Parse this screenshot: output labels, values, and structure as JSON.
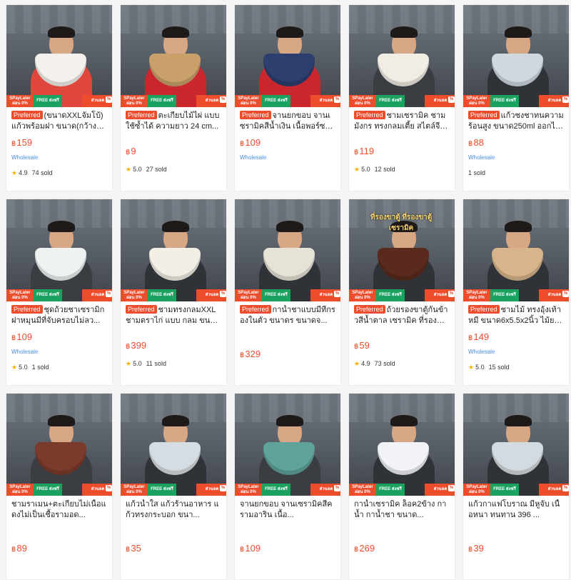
{
  "colors": {
    "accent": "#ee4d2d",
    "wholesale": "#4a90e2",
    "star": "#f5b301",
    "ship": "#1aa260"
  },
  "currency": "฿",
  "badges": {
    "paylater": "SPayLater ผ่อน 0%",
    "shipping": "FREE ส่งฟรี",
    "discount": "ส่วนลด"
  },
  "products": [
    {
      "tag": "Preferred",
      "title": "(ขนาดXXLจัมโบ้)แก้วพร้อมฝา ขนาด(กว้าง4.5สูง...",
      "price": "159",
      "wholesale": "Wholesale",
      "rating": "4.9",
      "sold": "74 sold",
      "shirt": "#e0463b",
      "product": "#f4f1ec",
      "overlay": ""
    },
    {
      "tag": "Preferred",
      "title": "ตะเกียบไม้ไผ่ แบบใช้ซ้ำได้ ความยาว 24 cm...",
      "price": "9",
      "wholesale": "",
      "rating": "5.0",
      "sold": "27 sold",
      "shirt": "#c9272d",
      "product": "#c9a06a",
      "overlay": ""
    },
    {
      "tag": "Preferred",
      "title": "จานยกขอบ จานเซรามิคสีน้ำเงิน เนื้อพอร์ซเล...",
      "price": "109",
      "wholesale": "Wholesale",
      "rating": "",
      "sold": "",
      "shirt": "#c9272d",
      "product": "#2c3f6e",
      "overlay": ""
    },
    {
      "tag": "Preferred",
      "title": "ชามเซรามิค ชามมังกร ทรงกลมเตี้ย สไตล์จีน ลา...",
      "price": "119",
      "wholesale": "",
      "rating": "5.0",
      "sold": "12 sold",
      "shirt": "#3a3d42",
      "product": "#f2ede4",
      "overlay": ""
    },
    {
      "tag": "Preferred",
      "title": "แก้วชงชาทนความร้อนสูง ขนาด250ml ออกไป...",
      "price": "88",
      "wholesale": "Wholesale",
      "rating": "",
      "sold": "1 sold",
      "shirt": "#2f3338",
      "product": "#cfd8de",
      "overlay": ""
    },
    {
      "tag": "Preferred",
      "title": "ชุดถ้วยชาเซรามิกฝาหมุนมีที่จับครอบไม่ลว...",
      "price": "109",
      "wholesale": "Wholesale",
      "rating": "5.0",
      "sold": "1 sold",
      "shirt": "#3a3d42",
      "product": "#eef2f0",
      "overlay": ""
    },
    {
      "tag": "Preferred",
      "title": "ชามทรงกลมXXL ชามตราไก่ แบบ กลม ขนาด...",
      "price": "399",
      "wholesale": "",
      "rating": "5.0",
      "sold": "11 sold",
      "shirt": "#2f3338",
      "product": "#f3efe6",
      "overlay": ""
    },
    {
      "tag": "Preferred",
      "title": "กาน้ำชาแบบมีที่กรองในตัว ขนาดร ขนาดจ...",
      "price": "329",
      "wholesale": "",
      "rating": "",
      "sold": "",
      "shirt": "#2f3338",
      "product": "#e7e2d6",
      "overlay": ""
    },
    {
      "tag": "Preferred",
      "title": "ถ้วยรองขาตู้กันข้าวสีน้ำตาล เซรามิค ที่รองขาตู้...",
      "price": "59",
      "wholesale": "",
      "rating": "4.9",
      "sold": "73 sold",
      "shirt": "#2f3338",
      "product": "#5a2a1c",
      "overlay": "ที่รองขาตู้ ที่รองขาตู้ เซรามิค"
    },
    {
      "tag": "Preferred",
      "title": "ชามไม้ ทรงอุ้งเท้าหมี ขนาด6x5.5x2นิ้ว ไม้ยาง...",
      "price": "149",
      "wholesale": "Wholesale",
      "rating": "5.0",
      "sold": "15 sold",
      "shirt": "#2f3338",
      "product": "#d8b48a",
      "overlay": ""
    },
    {
      "tag": "",
      "title": "ชามราเมน+ตะเกียบไม่เนื้อแดงไม่เป็นเชื้อรามอด...",
      "price": "89",
      "wholesale": "",
      "rating": "",
      "sold": "",
      "shirt": "#3a3d42",
      "product": "#7b3b2c",
      "overlay": ""
    },
    {
      "tag": "",
      "title": "แก้วน้ำใส แก้วร้านอาหาร แก้วทรงกระบอก ขนา...",
      "price": "35",
      "wholesale": "",
      "rating": "",
      "sold": "",
      "shirt": "#2f3338",
      "product": "#d6dde2",
      "overlay": ""
    },
    {
      "tag": "",
      "title": "จานยกขอบ จานเซรามิคสีครามอาริน เนื้อ...",
      "price": "109",
      "wholesale": "",
      "rating": "",
      "sold": "",
      "shirt": "#3a3d42",
      "product": "#5fa39a",
      "overlay": ""
    },
    {
      "tag": "",
      "title": "กาน้ำเซรามิค ล็อค2ข้าง กาน้ำ กาน้ำชา ขนาด...",
      "price": "269",
      "wholesale": "",
      "rating": "",
      "sold": "",
      "shirt": "#2f3338",
      "product": "#f1f3f7",
      "overlay": ""
    },
    {
      "tag": "",
      "title": "แก้วกาแฟโบราณ มีหูจับ เนื้อหนา ทนทาน 396 ...",
      "price": "39",
      "wholesale": "",
      "rating": "",
      "sold": "",
      "shirt": "#2f3338",
      "product": "#d4dbe0",
      "overlay": ""
    }
  ]
}
